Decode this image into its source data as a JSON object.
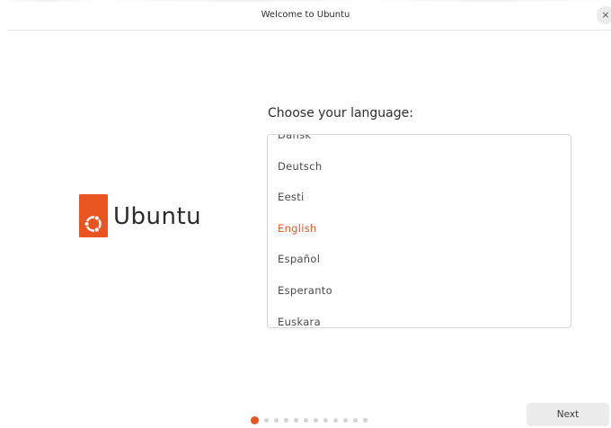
{
  "window": {
    "title": "Welcome to Ubuntu",
    "close_icon": "×"
  },
  "brand": {
    "name": "Ubuntu",
    "color": "#e95420"
  },
  "language": {
    "heading": "Choose your language:",
    "items": [
      "Dansk",
      "Deutsch",
      "Eesti",
      "English",
      "Español",
      "Esperanto",
      "Euskara"
    ],
    "selected": "English",
    "selected_color": "#e05a1e"
  },
  "progress": {
    "total_steps": 12,
    "current_step": 1
  },
  "footer": {
    "next_label": "Next"
  }
}
